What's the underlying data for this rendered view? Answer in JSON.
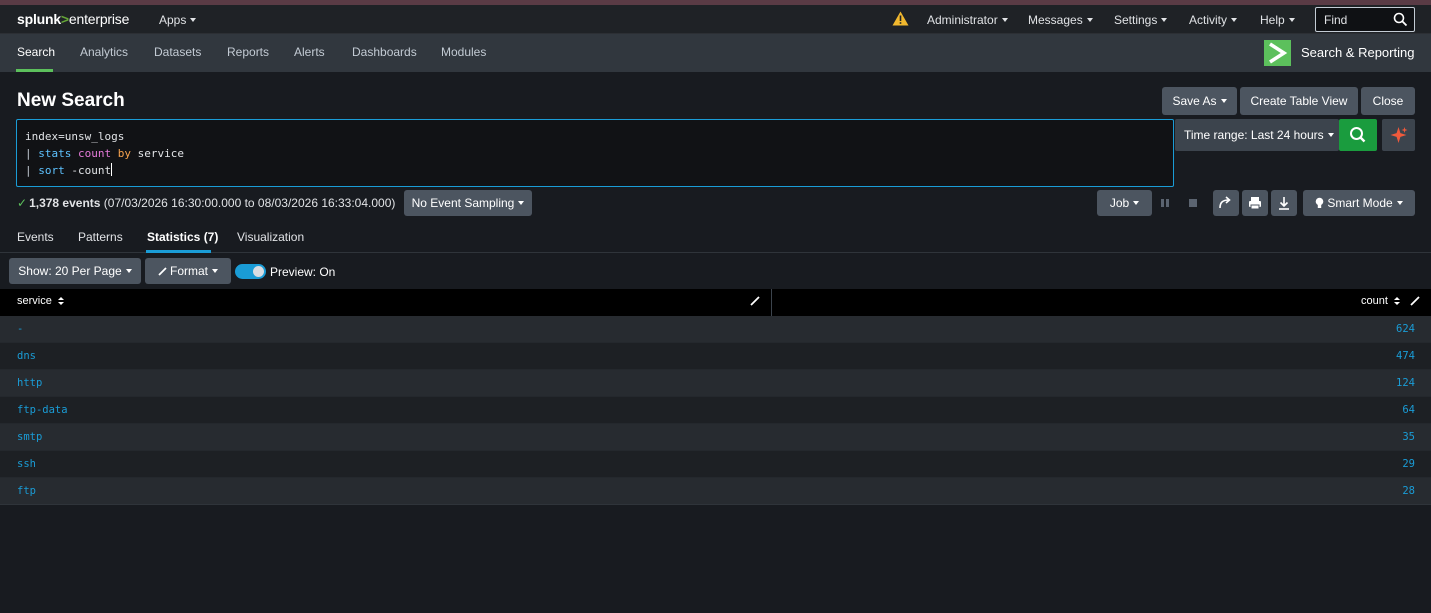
{
  "topbar": {
    "logo_brand": "splunk",
    "logo_gt": ">",
    "logo_product": "enterprise",
    "apps": "Apps",
    "administrator": "Administrator",
    "messages": "Messages",
    "settings": "Settings",
    "activity": "Activity",
    "help": "Help",
    "find_placeholder": "Find",
    "warning_icon": "warning-triangle-icon",
    "warning_color": "#f1b82e"
  },
  "appbar": {
    "items": [
      "Search",
      "Analytics",
      "Datasets",
      "Reports",
      "Alerts",
      "Dashboards",
      "Modules"
    ],
    "active": "Search",
    "app_title": "Search & Reporting",
    "accent": "#5cc05c"
  },
  "page": {
    "title": "New Search",
    "save_as": "Save As",
    "create_table_view": "Create Table View",
    "close": "Close"
  },
  "search": {
    "line1": "index=unsw_logs",
    "line2_pipe": "|",
    "line2_cmd": "stats",
    "line2_func": "count",
    "line2_by": "by",
    "line2_field": "service",
    "line3_pipe": "|",
    "line3_cmd": "sort",
    "line3_arg": "-count",
    "time_range": "Time range: Last 24 hours"
  },
  "status": {
    "count": "1,378 events",
    "range": "(07/03/2026 16:30:00.000 to 08/03/2026 16:33:04.000)",
    "sampling": "No Event Sampling",
    "job": "Job",
    "smart_mode": "Smart Mode"
  },
  "tabs": {
    "items": [
      "Events",
      "Patterns",
      "Statistics (7)",
      "Visualization"
    ],
    "active": "Statistics (7)"
  },
  "controls": {
    "show": "Show: 20 Per Page",
    "format": "Format",
    "preview": "Preview: On",
    "preview_on": true
  },
  "table": {
    "columns": [
      "service",
      "count"
    ],
    "rows": [
      {
        "service": "-",
        "count": "624"
      },
      {
        "service": "dns",
        "count": "474"
      },
      {
        "service": "http",
        "count": "124"
      },
      {
        "service": "ftp-data",
        "count": "64"
      },
      {
        "service": "smtp",
        "count": "35"
      },
      {
        "service": "ssh",
        "count": "29"
      },
      {
        "service": "ftp",
        "count": "28"
      }
    ],
    "link_color": "#1a9cd6"
  }
}
